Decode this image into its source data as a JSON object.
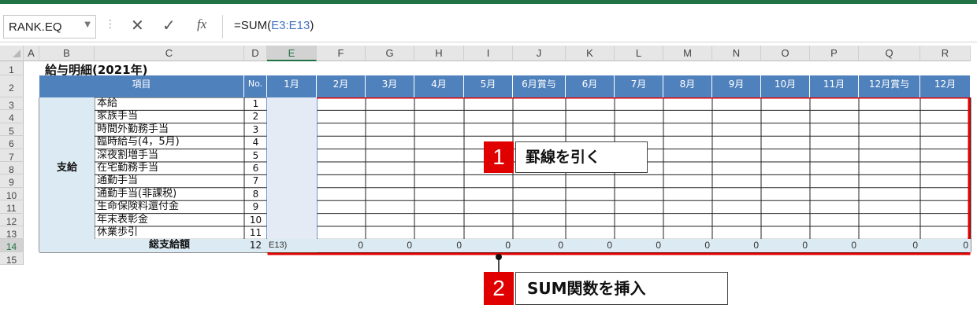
{
  "formula_bar": {
    "name_box": "RANK.EQ",
    "cancel_icon": "✕",
    "enter_icon": "✓",
    "fx_label": "fx",
    "formula_prefix": "=SUM(",
    "formula_ref": "E3:E13",
    "formula_suffix": ")"
  },
  "column_headers": [
    "A",
    "B",
    "C",
    "D",
    "E",
    "F",
    "G",
    "H",
    "I",
    "J",
    "K",
    "L",
    "M",
    "N",
    "O",
    "P",
    "Q",
    "R"
  ],
  "row_headers": [
    "1",
    "2",
    "3",
    "4",
    "5",
    "6",
    "7",
    "8",
    "9",
    "10",
    "11",
    "12",
    "13",
    "14",
    "15"
  ],
  "sheet": {
    "title": "給与明細(2021年)",
    "header_item": "項目",
    "header_no": "No.",
    "months": [
      "1月",
      "2月",
      "3月",
      "4月",
      "5月",
      "6月賞与",
      "6月",
      "7月",
      "8月",
      "9月",
      "10月",
      "11月",
      "12月賞与",
      "12月"
    ],
    "group_label": "支給",
    "items": [
      {
        "name": "本給",
        "no": "1"
      },
      {
        "name": "家族手当",
        "no": "2"
      },
      {
        "name": "時間外勤務手当",
        "no": "3"
      },
      {
        "name": "臨時給与(4，5月)",
        "no": "4"
      },
      {
        "name": "深夜割増手当",
        "no": "5"
      },
      {
        "name": "在宅勤務手当",
        "no": "6"
      },
      {
        "name": "通勤手当",
        "no": "7"
      },
      {
        "name": "通勤手当(非課税)",
        "no": "8"
      },
      {
        "name": "生命保険料還付金",
        "no": "9"
      },
      {
        "name": "年末表彰金",
        "no": "10"
      },
      {
        "name": "休業歩引",
        "no": "11"
      }
    ],
    "total_label": "総支給額",
    "total_no": "12",
    "total_edit": "E13)",
    "total_values": [
      "0",
      "0",
      "0",
      "0",
      "0",
      "0",
      "0",
      "0",
      "0",
      "0",
      "0",
      "0",
      "0"
    ]
  },
  "callouts": [
    {
      "number": "1",
      "text": "罫線を引く"
    },
    {
      "number": "2",
      "text": "SUM関数を挿入"
    }
  ],
  "colors": {
    "accent": "#217346",
    "header_blue": "#4f81bd",
    "highlight_red": "#e00000",
    "light_fill": "#dcebf3"
  }
}
